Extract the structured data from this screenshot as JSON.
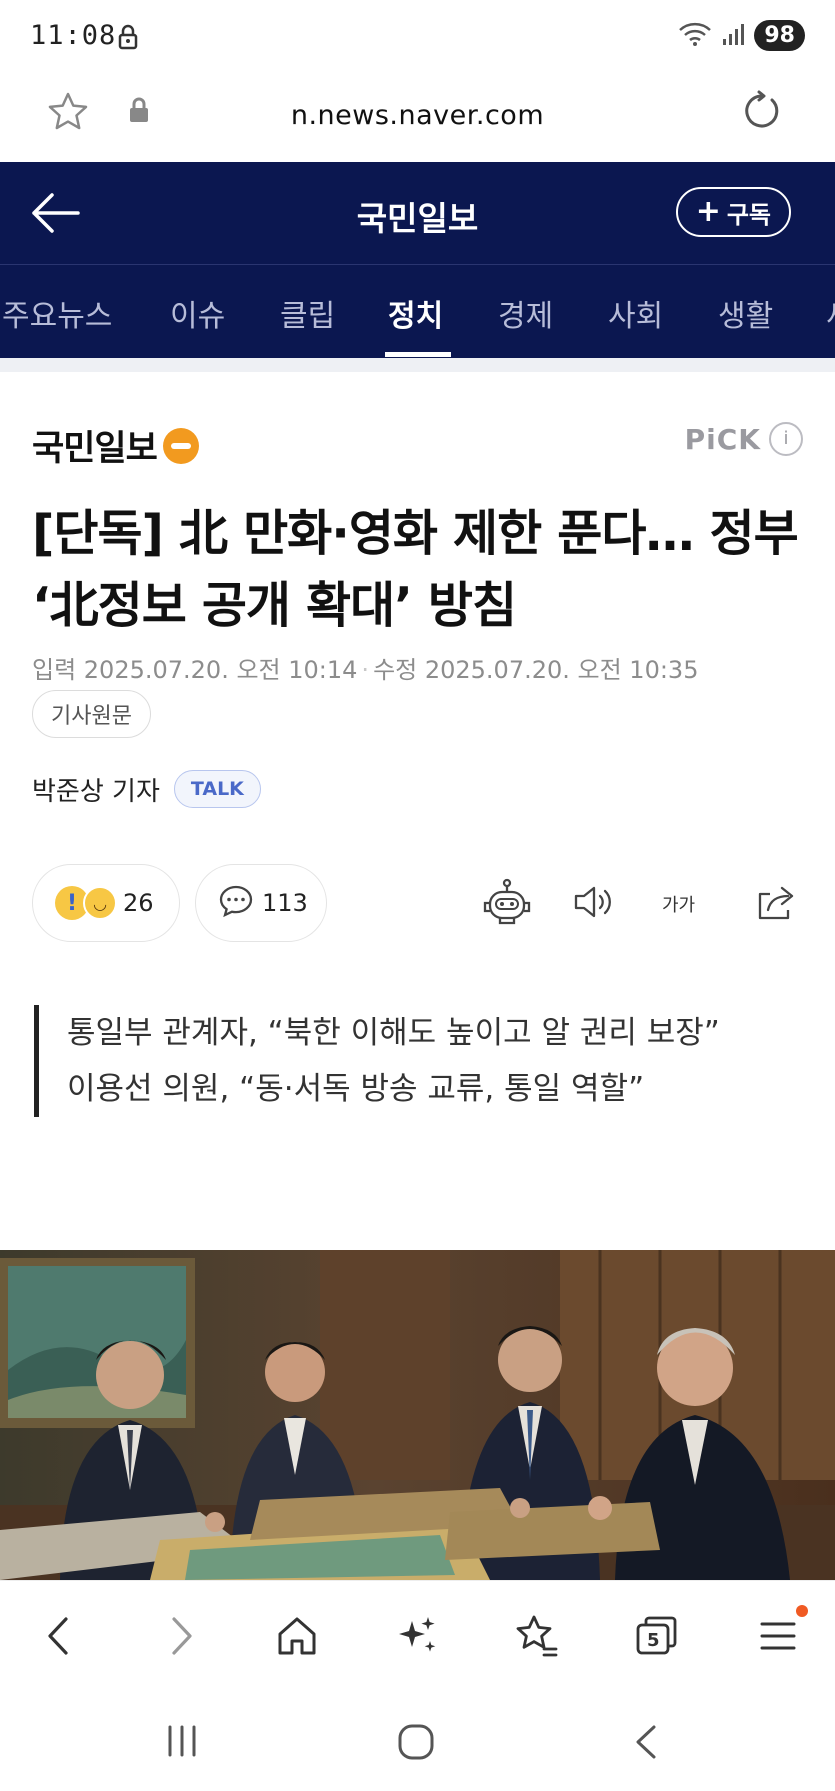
{
  "status_bar": {
    "time": "11:08",
    "battery": "98"
  },
  "browser": {
    "url": "n.news.naver.com"
  },
  "publisher_header": {
    "title": "국민일보",
    "subscribe_label": "구독"
  },
  "tabs": [
    {
      "label": "주요뉴스",
      "active": false
    },
    {
      "label": "이슈",
      "active": false
    },
    {
      "label": "클립",
      "active": false
    },
    {
      "label": "정치",
      "active": true
    },
    {
      "label": "경제",
      "active": false
    },
    {
      "label": "사회",
      "active": false
    },
    {
      "label": "생활",
      "active": false
    },
    {
      "label": "세",
      "active": false
    }
  ],
  "article": {
    "press_name": "국민일보",
    "pick_label": "PiCK",
    "headline": "[단독] 北 만화·영화 제한 푼다… 정부 ‘北정보 공개 확대’ 방침",
    "published": "입력 2025.07.20. 오전 10:14",
    "modified": "수정 2025.07.20. 오전 10:35",
    "source_label": "기사원문",
    "reporter": "박준상 기자",
    "talk_label": "TALK",
    "reaction_count": "26",
    "comment_count": "113",
    "font_size_label": "가가",
    "summary": [
      "통일부 관계자, “북한 이해도 높이고 알 권리 보장”",
      "이용선 의원, “동·서독 방송 교류, 통일 역할”"
    ]
  },
  "bottom_nav": {
    "tab_count": "5"
  },
  "colors": {
    "header_bg": "#0b1750",
    "logo_orange": "#f29a1f",
    "talk_blue": "#4a69c8",
    "notification_dot": "#f05a23"
  }
}
